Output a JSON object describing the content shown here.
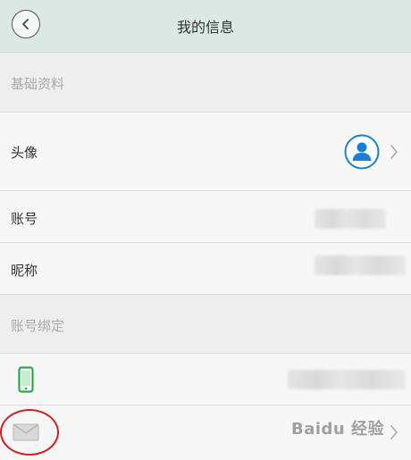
{
  "header": {
    "title": "我的信息",
    "back_icon": "chevron-left-icon"
  },
  "sections": {
    "basic_info": "基础资料",
    "account_binding": "账号绑定"
  },
  "rows": {
    "avatar": {
      "label": "头像",
      "icon": "user-avatar-icon"
    },
    "account": {
      "label": "账号"
    },
    "nickname": {
      "label": "昵称"
    },
    "phone": {
      "icon": "phone-icon"
    },
    "email": {
      "icon": "envelope-icon"
    }
  },
  "watermark": "Baidu 经验",
  "colors": {
    "header_bg": "#dce8e4",
    "avatar_blue": "#1a7fd6",
    "phone_green": "#2aa84a",
    "highlight_red": "#d42020"
  }
}
